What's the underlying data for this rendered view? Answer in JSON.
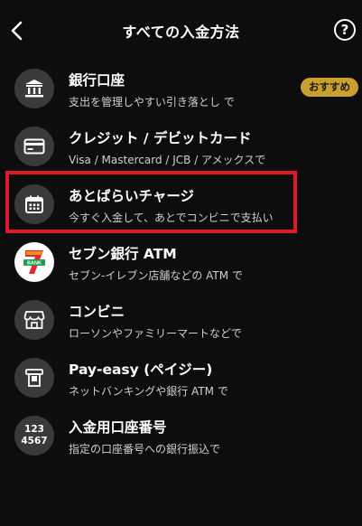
{
  "header": {
    "title": "すべての入金方法",
    "back_icon": "chevron-left-icon",
    "help_label": "?"
  },
  "colors": {
    "background": "#0d0d0d",
    "icon_circle": "#3a3a3a",
    "badge": "#c9a02f",
    "highlight": "#e0182a"
  },
  "methods": [
    {
      "label": "銀行口座",
      "sub": "支出を管理しやすい引き落とし で",
      "icon": "bank-icon",
      "badge": "おすすめ"
    },
    {
      "label": "クレジット / デビットカード",
      "sub": "Visa / Mastercard / JCB / アメックスで",
      "icon": "credit-card-icon"
    },
    {
      "label": "あとばらいチャージ",
      "sub": "今すぐ入金して、あとでコンビニで支払い",
      "icon": "calendar-icon"
    },
    {
      "label": "セブン銀行 ATM",
      "sub": "セブン-イレブン店舗などの ATM で",
      "icon": "seven-bank-logo-icon"
    },
    {
      "label": "コンビニ",
      "sub": "ローソンやファミリーマートなどで",
      "icon": "store-icon"
    },
    {
      "label": "Pay-easy (ペイジー)",
      "sub": "ネットバンキングや銀行 ATM で",
      "icon": "atm-icon"
    },
    {
      "label": "入金用口座番号",
      "sub": "指定の口座番号への銀行振込で",
      "icon": "account-number-icon",
      "icon_text_1": "123",
      "icon_text_2": "4567"
    }
  ]
}
